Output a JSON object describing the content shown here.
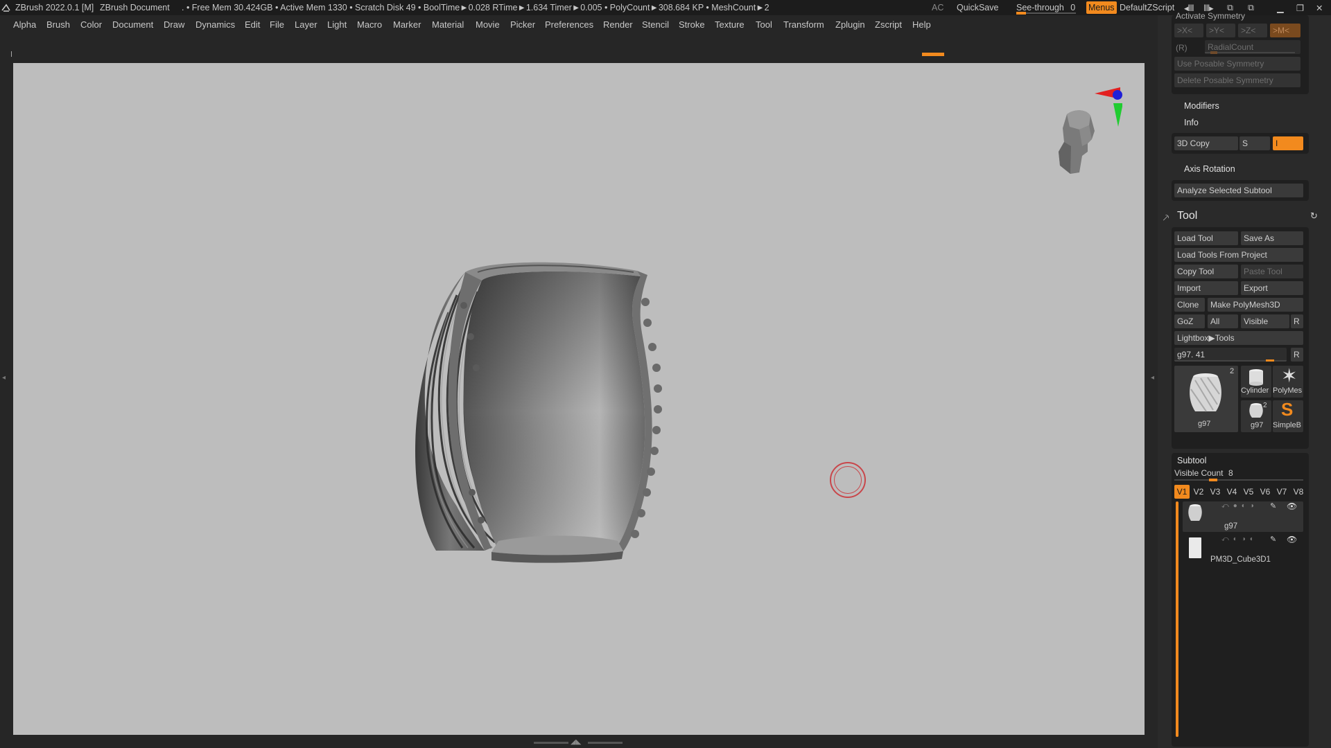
{
  "titlebar": {
    "app_title": "ZBrush 2022.0.1 [M]",
    "document": "ZBrush Document",
    "stats": ". • Free Mem 30.424GB • Active Mem 1330 • Scratch Disk 49 •  BoolTime►0.028 RTime►1.634 Timer►0.005 • PolyCount►308.684 KP  • MeshCount►2",
    "ac": "AC",
    "quicksave": "QuickSave",
    "see_through_label": "See-through",
    "see_through_value": "0",
    "menus": "Menus",
    "default_zscript": "DefaultZScript"
  },
  "menubar": [
    "Alpha",
    "Brush",
    "Color",
    "Document",
    "Draw",
    "Dynamics",
    "Edit",
    "File",
    "Layer",
    "Light",
    "Macro",
    "Marker",
    "Material",
    "Movie",
    "Picker",
    "Preferences",
    "Render",
    "Stencil",
    "Stroke",
    "Texture",
    "Tool",
    "Transform",
    "Zplugin",
    "Zscript",
    "Help"
  ],
  "colors": {
    "accent": "#f28a1e",
    "canvas": "#bdbdbd",
    "bg": "#262626",
    "panel": "#2a2a2a"
  },
  "panel": {
    "symmetry": {
      "activate": "Activate Symmetry",
      "x": ">X<",
      "y": ">Y<",
      "z": ">Z<",
      "m": ">M<",
      "r": "(R)",
      "radialcount": "RadialCount",
      "use_posable": "Use Posable Symmetry",
      "delete_posable": "Delete Posable Symmetry"
    },
    "modifiers": "Modifiers",
    "info": "Info",
    "copy3d": "3D Copy",
    "s": "S",
    "i": "I",
    "axis_rotation": "Axis Rotation",
    "analyze": "Analyze Selected Subtool",
    "tool_title": "Tool",
    "tool_buttons": {
      "load_tool": "Load Tool",
      "save_as": "Save As",
      "load_from_project": "Load Tools From Project",
      "copy_tool": "Copy Tool",
      "paste_tool": "Paste Tool",
      "import": "Import",
      "export": "Export",
      "clone": "Clone",
      "make_polymesh": "Make PolyMesh3D",
      "goz": "GoZ",
      "all": "All",
      "visible": "Visible",
      "r": "R",
      "lightbox_tools": "Lightbox▶Tools"
    },
    "current_tool": "g97. 41",
    "current_tool_r": "R",
    "thumbs": {
      "main_name": "g97",
      "main_count": "2",
      "cylinder": "Cylinder",
      "polymesh": "PolyMes",
      "small_g97": "g97",
      "small_count": "2",
      "simpleb": "SimpleB"
    },
    "subtool": {
      "title": "Subtool",
      "visible_count_label": "Visible Count",
      "visible_count": "8",
      "versions": [
        "V1",
        "V2",
        "V3",
        "V4",
        "V5",
        "V6",
        "V7",
        "V8"
      ],
      "items": [
        {
          "name": "g97"
        },
        {
          "name": "PM3D_Cube3D1"
        }
      ]
    }
  }
}
